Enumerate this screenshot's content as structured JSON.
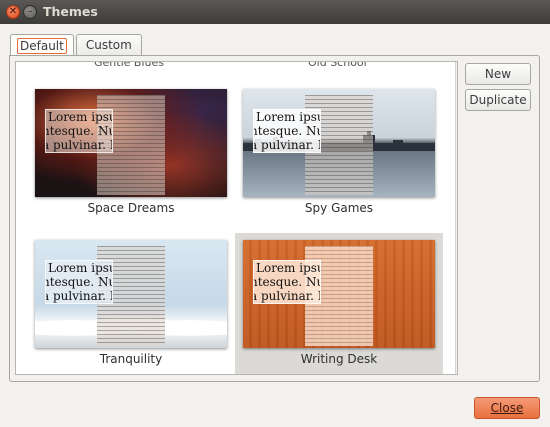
{
  "window": {
    "title": "Themes"
  },
  "tabs": [
    {
      "label": "Default",
      "active": true
    },
    {
      "label": "Custom",
      "active": false
    }
  ],
  "themes_partial_top": [
    "Gentle Blues",
    "Old School"
  ],
  "themes": [
    {
      "name": "Space Dreams",
      "selected": false,
      "preview_text": [
        "Lorem ipsu",
        "ntesque. Nulla",
        "a pulvinar. Ma"
      ]
    },
    {
      "name": "Spy Games",
      "selected": false,
      "preview_text": [
        "Lorem ipsu",
        "ntesque. Nulla",
        "a pulvinar. Ma"
      ]
    },
    {
      "name": "Tranquility",
      "selected": false,
      "preview_text": [
        "Lorem ipsu",
        "ntesque. Nulla",
        "a pulvinar. Ma"
      ]
    },
    {
      "name": "Writing Desk",
      "selected": true,
      "preview_text": [
        "Lorem ipsu",
        "ntesque. Nulla",
        "a pulvinar. Ma"
      ]
    }
  ],
  "buttons": {
    "new": "New",
    "duplicate": "Duplicate",
    "close": "Close"
  },
  "icons": {
    "window_close": "close-icon",
    "window_minimize": "minimize-icon",
    "scroll_up": "scroll-up-arrow-icon",
    "scroll_down": "scroll-down-arrow-icon"
  },
  "colors": {
    "accent": "#e9703f",
    "titlebar": "#3c3b37",
    "selection": "#dcdad6"
  }
}
